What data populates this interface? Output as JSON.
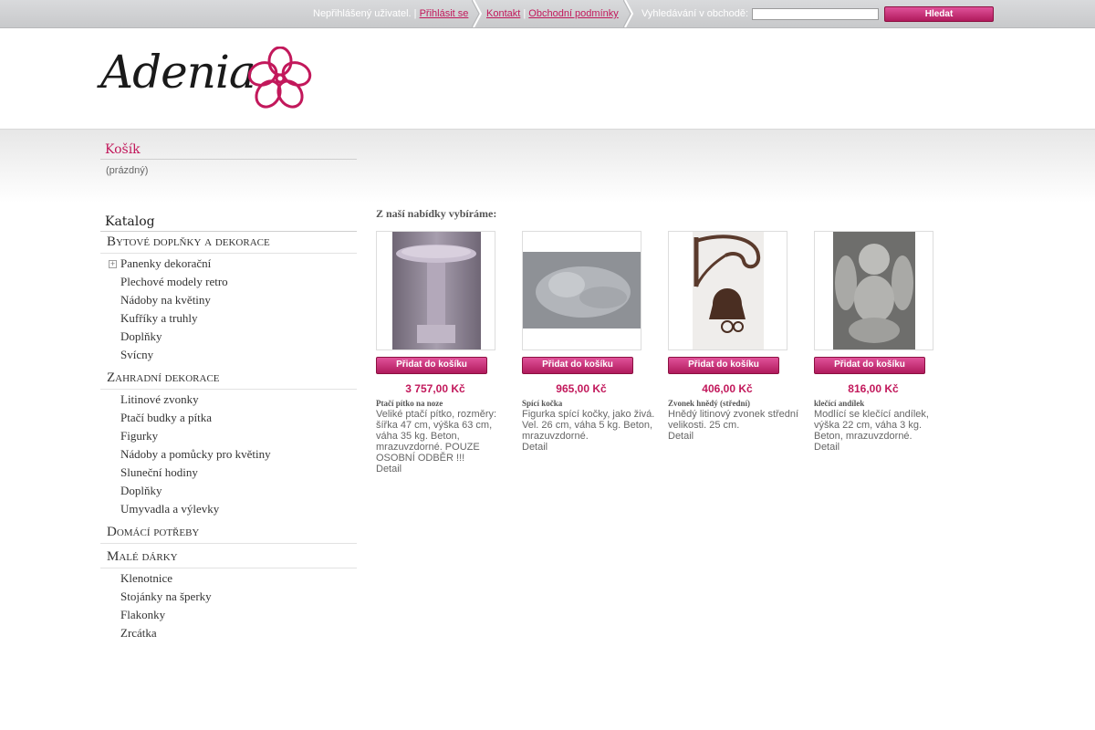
{
  "topbar": {
    "user_status": "Nepřihlášený uživatel. |",
    "login_link": "Přihlásit se",
    "contact_link": "Kontakt",
    "separator": "|",
    "terms_link": "Obchodní podmínky",
    "search_label": "Vyhledávání v obchodě:",
    "search_value": "",
    "search_button": "Hledat"
  },
  "logo": {
    "text": "Adenia",
    "accent_color": "#c2185b"
  },
  "cart": {
    "title": "Košík",
    "status": "(prázdný)"
  },
  "catalog": {
    "title": "Katalog",
    "categories": [
      {
        "label": "Bytové doplňky a dekorace",
        "items": [
          "Panenky dekorační",
          "Plechové modely retro",
          "Nádoby na květiny",
          "Kufříky a truhly",
          "Doplňky",
          "Svícny"
        ]
      },
      {
        "label": "Zahradní dekorace",
        "items": [
          "Litinové zvonky",
          "Ptačí budky a pítka",
          "Figurky",
          "Nádoby a pomůcky pro květiny",
          "Sluneční hodiny",
          "Doplňky",
          "Umyvadla a výlevky"
        ]
      },
      {
        "label": "Domácí potřeby",
        "items": []
      },
      {
        "label": "Malé dárky",
        "items": [
          "Klenotnice",
          "Stojánky na šperky",
          "Flakonky",
          "Zrcátka"
        ]
      }
    ]
  },
  "offer": {
    "title": "Z naší nabídky vybíráme:",
    "add_label": "Přidat do košíku",
    "detail_label": "Detail",
    "products": [
      {
        "name": "Ptačí pítko na noze",
        "price": "3 757,00 Kč",
        "description": "Veliké ptačí pítko, rozměry: šířka 47 cm, výška 63 cm, váha 35 kg. Beton, mrazuvzdorné. POUZE OSOBNÍ ODBĚR !!!"
      },
      {
        "name": "Spící kočka",
        "price": "965,00 Kč",
        "description": "Figurka spící kočky, jako živá. Vel. 26 cm, váha 5 kg. Beton, mrazuvzdorné."
      },
      {
        "name": "Zvonek hnědý (střední)",
        "price": "406,00 Kč",
        "description": "Hnědý litinový zvonek střední velikosti. 25 cm."
      },
      {
        "name": "klečící andílek",
        "price": "816,00 Kč",
        "description": "Modlící se klečící andílek, výška 22 cm, váha 3 kg. Beton, mrazuvzdorné."
      }
    ]
  }
}
